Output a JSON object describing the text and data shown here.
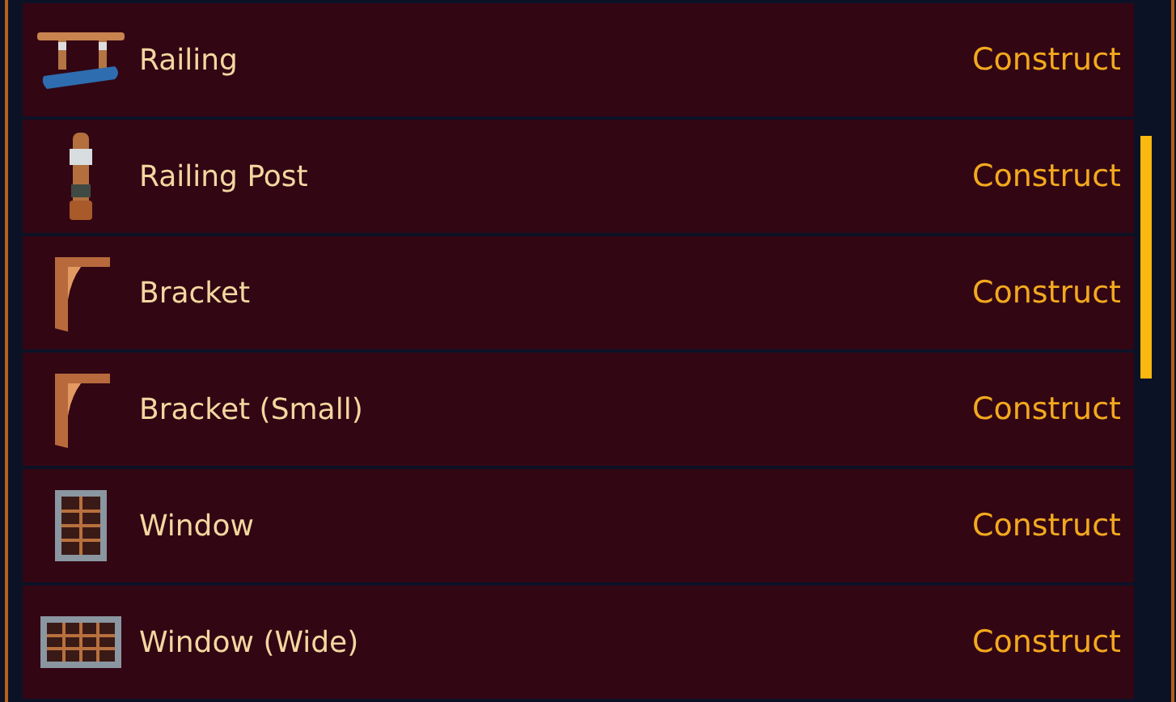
{
  "recipes": [
    {
      "kind": "railing",
      "name": "Railing",
      "action": "Construct"
    },
    {
      "kind": "post",
      "name": "Railing Post",
      "action": "Construct"
    },
    {
      "kind": "bracket",
      "name": "Bracket",
      "action": "Construct"
    },
    {
      "kind": "bracket",
      "name": "Bracket (Small)",
      "action": "Construct"
    },
    {
      "kind": "window",
      "name": "Window",
      "action": "Construct"
    },
    {
      "kind": "window-wide",
      "name": "Window (Wide)",
      "action": "Construct"
    }
  ]
}
